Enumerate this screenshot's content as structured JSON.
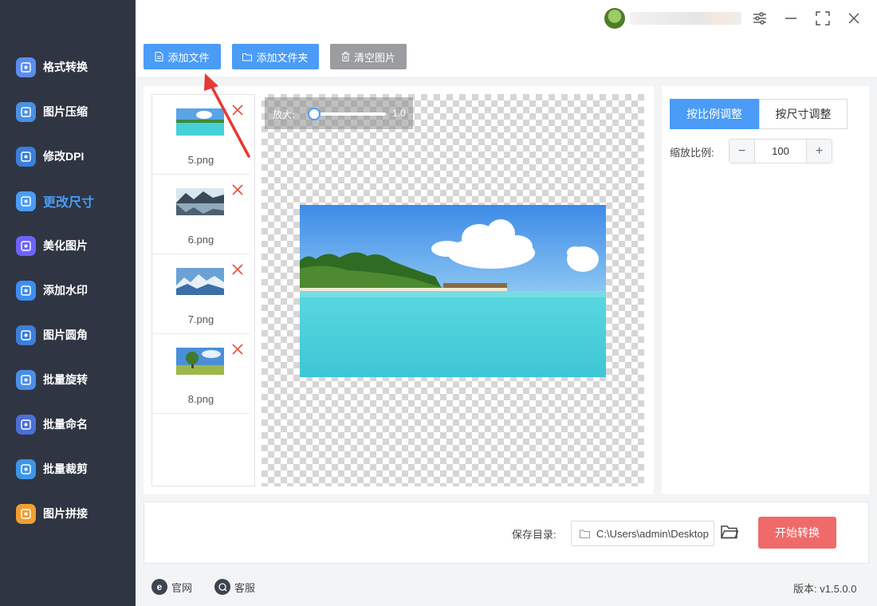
{
  "sidebar": {
    "items": [
      {
        "label": "格式转换",
        "icon": "format-convert-icon",
        "color": "#5b8def"
      },
      {
        "label": "图片压缩",
        "icon": "compress-icon",
        "color": "#4a90e2"
      },
      {
        "label": "修改DPI",
        "icon": "dpi-icon",
        "color": "#3b7fd9"
      },
      {
        "label": "更改尺寸",
        "icon": "resize-icon",
        "color": "#4a9cf7",
        "active": true
      },
      {
        "label": "美化图片",
        "icon": "beautify-icon",
        "color": "#6c63ff"
      },
      {
        "label": "添加水印",
        "icon": "watermark-icon",
        "color": "#3d8ef0"
      },
      {
        "label": "图片圆角",
        "icon": "round-corner-icon",
        "color": "#3b7fd9"
      },
      {
        "label": "批量旋转",
        "icon": "rotate-icon",
        "color": "#4a8fe8"
      },
      {
        "label": "批量命名",
        "icon": "rename-icon",
        "color": "#4a6fd8"
      },
      {
        "label": "批量裁剪",
        "icon": "crop-icon",
        "color": "#3e95e6"
      },
      {
        "label": "图片拼接",
        "icon": "puzzle-icon",
        "color": "#f0a030"
      }
    ]
  },
  "toolbar": {
    "add_file": "添加文件",
    "add_folder": "添加文件夹",
    "clear_images": "清空图片"
  },
  "files": [
    {
      "name": "5.png"
    },
    {
      "name": "6.png"
    },
    {
      "name": "7.png"
    },
    {
      "name": "8.png"
    }
  ],
  "zoom": {
    "label": "放大:",
    "value": "1.0"
  },
  "right_panel": {
    "tab_ratio": "按比例调整",
    "tab_size": "按尺寸调整",
    "scale_label": "缩放比例:",
    "scale_value": "100",
    "minus": "−",
    "plus": "+"
  },
  "bottom": {
    "save_label": "保存目录:",
    "save_path": "C:\\Users\\admin\\Desktop",
    "start_button": "开始转换"
  },
  "footer": {
    "website": "官网",
    "website_icon": "e",
    "support": "客服",
    "version": "版本: v1.5.0.0"
  },
  "colors": {
    "accent": "#4a9cf7",
    "sidebar_bg": "#2f3542",
    "start": "#f06a6a",
    "delete": "#e74c3c"
  }
}
